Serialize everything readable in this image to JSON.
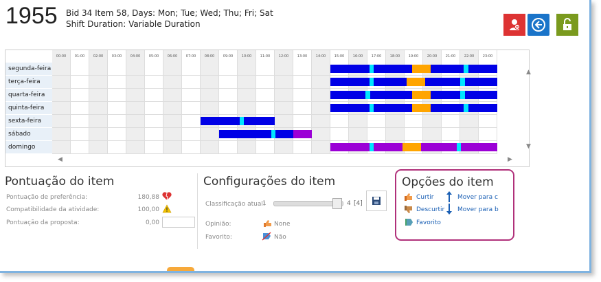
{
  "header": {
    "id_number": "1955",
    "line1": "Bid 34 Item 58, Days: Mon; Tue; Wed; Thu; Fri; Sat",
    "line2": "Shift Duration: Variable Duration"
  },
  "toolbar": {
    "red_icon": "user-remove-icon",
    "back_icon": "arrow-left-icon",
    "lock_icon": "unlock-icon",
    "red_color": "#dd3333",
    "blue_color": "#1a74c9",
    "green_color": "#7a9a1e"
  },
  "schedule": {
    "hours": [
      "00:00",
      "01:00",
      "02:00",
      "03:00",
      "04:00",
      "05:00",
      "06:00",
      "07:00",
      "08:00",
      "09:00",
      "10:00",
      "11:00",
      "12:00",
      "13:00",
      "14:00",
      "15:00",
      "16:00",
      "17:00",
      "18:00",
      "19:00",
      "20:00",
      "21:00",
      "22:00",
      "23:00"
    ],
    "days": [
      "segunda-feira",
      "terça-feira",
      "quarta-feira",
      "quinta-feira",
      "sexta-feira",
      "sábado",
      "domingo"
    ],
    "colors": {
      "work": "#0000e6",
      "cyan": "#00e5ff",
      "orange": "#ffa500",
      "purple": "#9b00d6"
    },
    "segments": [
      [
        {
          "start": 15,
          "end": 17.1,
          "c": "work"
        },
        {
          "start": 17.1,
          "end": 17.35,
          "c": "cyan"
        },
        {
          "start": 17.35,
          "end": 19.4,
          "c": "work"
        },
        {
          "start": 19.4,
          "end": 20.4,
          "c": "orange"
        },
        {
          "start": 20.4,
          "end": 22.2,
          "c": "work"
        },
        {
          "start": 22.2,
          "end": 22.45,
          "c": "cyan"
        },
        {
          "start": 22.45,
          "end": 24,
          "c": "work"
        }
      ],
      [
        {
          "start": 15,
          "end": 17.1,
          "c": "work"
        },
        {
          "start": 17.1,
          "end": 17.35,
          "c": "cyan"
        },
        {
          "start": 17.35,
          "end": 19.1,
          "c": "work"
        },
        {
          "start": 19.1,
          "end": 20.1,
          "c": "orange"
        },
        {
          "start": 20.1,
          "end": 22.0,
          "c": "work"
        },
        {
          "start": 22.0,
          "end": 22.25,
          "c": "cyan"
        },
        {
          "start": 22.25,
          "end": 24,
          "c": "work"
        }
      ],
      [
        {
          "start": 15,
          "end": 16.9,
          "c": "work"
        },
        {
          "start": 16.9,
          "end": 17.15,
          "c": "cyan"
        },
        {
          "start": 17.15,
          "end": 19.4,
          "c": "work"
        },
        {
          "start": 19.4,
          "end": 20.4,
          "c": "orange"
        },
        {
          "start": 20.4,
          "end": 22.0,
          "c": "work"
        },
        {
          "start": 22.0,
          "end": 22.25,
          "c": "cyan"
        },
        {
          "start": 22.25,
          "end": 24,
          "c": "work"
        }
      ],
      [
        {
          "start": 15,
          "end": 17.1,
          "c": "work"
        },
        {
          "start": 17.1,
          "end": 17.35,
          "c": "cyan"
        },
        {
          "start": 17.35,
          "end": 19.4,
          "c": "work"
        },
        {
          "start": 19.4,
          "end": 20.4,
          "c": "orange"
        },
        {
          "start": 20.4,
          "end": 22.2,
          "c": "work"
        },
        {
          "start": 22.2,
          "end": 22.45,
          "c": "cyan"
        },
        {
          "start": 22.45,
          "end": 24,
          "c": "work"
        }
      ],
      [
        {
          "start": 8,
          "end": 10.1,
          "c": "work"
        },
        {
          "start": 10.1,
          "end": 10.35,
          "c": "cyan"
        },
        {
          "start": 10.35,
          "end": 12,
          "c": "work"
        }
      ],
      [
        {
          "start": 9,
          "end": 11.8,
          "c": "work"
        },
        {
          "start": 11.8,
          "end": 12.05,
          "c": "cyan"
        },
        {
          "start": 12.05,
          "end": 13,
          "c": "work"
        },
        {
          "start": 13,
          "end": 14,
          "c": "purple"
        }
      ],
      [
        {
          "start": 15,
          "end": 17.1,
          "c": "purple"
        },
        {
          "start": 17.1,
          "end": 17.35,
          "c": "cyan"
        },
        {
          "start": 17.35,
          "end": 18.9,
          "c": "purple"
        },
        {
          "start": 18.9,
          "end": 19.9,
          "c": "orange"
        },
        {
          "start": 19.9,
          "end": 21.8,
          "c": "purple"
        },
        {
          "start": 21.8,
          "end": 22.05,
          "c": "cyan"
        },
        {
          "start": 22.05,
          "end": 24,
          "c": "purple"
        }
      ]
    ]
  },
  "score": {
    "title": "Pontuação do item",
    "rows": [
      {
        "label": "Pontuação de preferência:",
        "value": "180,88",
        "icon": "broken-heart-icon"
      },
      {
        "label": "Compatibilidade da atividade:",
        "value": "100,00",
        "icon": "warning-icon"
      },
      {
        "label": "Pontuação da proposta:",
        "value": "0,00",
        "icon": ""
      }
    ]
  },
  "config": {
    "title": "Configurações do item",
    "class_label": "Classificação atual:",
    "slider_min": "1",
    "slider_max": "4",
    "slider_current": "[4]",
    "opinion_label": "Opinião:",
    "opinion_value": "None",
    "favorite_label": "Favorito:",
    "favorite_value": "Não"
  },
  "options": {
    "title": "Opções do item",
    "like": "Curtir",
    "dislike": "Descurtir",
    "favorite": "Favorito",
    "move_up": "Mover para c",
    "move_down": "Mover para b"
  }
}
